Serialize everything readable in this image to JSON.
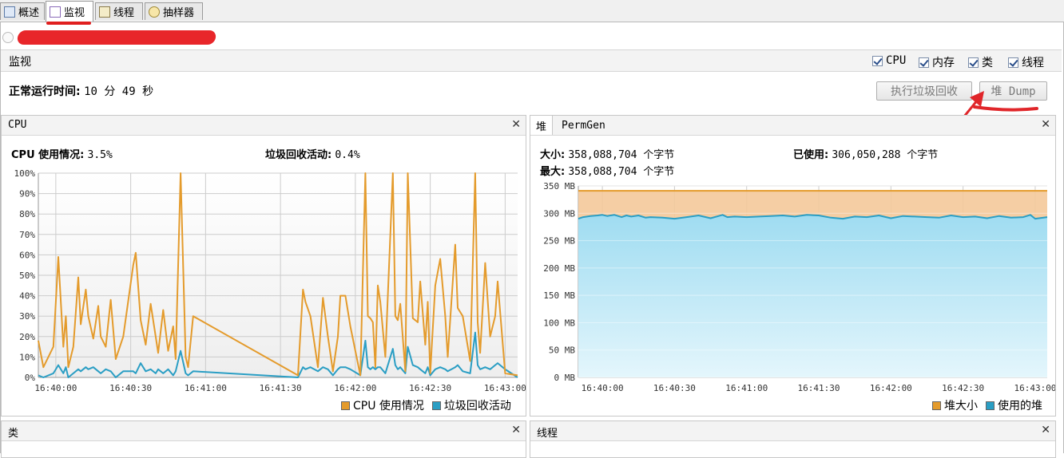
{
  "tabs": [
    {
      "label": "概述",
      "icon": "overview-icon"
    },
    {
      "label": "监视",
      "icon": "monitor-chart-icon"
    },
    {
      "label": "线程",
      "icon": "threads-icon"
    },
    {
      "label": "抽样器",
      "icon": "sampler-icon"
    }
  ],
  "monitor": {
    "title": "监视",
    "checkboxes": [
      {
        "label": "CPU",
        "checked": true
      },
      {
        "label": "内存",
        "checked": true
      },
      {
        "label": "类",
        "checked": true
      },
      {
        "label": "线程",
        "checked": true
      }
    ],
    "uptime_label": "正常运行时间:",
    "uptime_value": "10 分 49 秒",
    "gc_button": "执行垃圾回收",
    "heap_dump_button": "堆 Dump"
  },
  "cpu_panel": {
    "title": "CPU",
    "usage_label": "CPU 使用情况:",
    "usage_value": "3.5%",
    "gc_label": "垃圾回收活动:",
    "gc_value": "0.4%",
    "legend": [
      "CPU 使用情况",
      "垃圾回收活动"
    ],
    "colors": {
      "cpu": "#e49b2c",
      "gc": "#2a9ec4"
    }
  },
  "heap_panel": {
    "tabs": [
      "堆",
      "PermGen"
    ],
    "size_label": "大小:",
    "size_value": "358,088,704 个字节",
    "max_label": "最大:",
    "max_value": "358,088,704 个字节",
    "used_label": "已使用:",
    "used_value": "306,050,288 个字节",
    "legend": [
      "堆大小",
      "使用的堆"
    ],
    "colors": {
      "size": "#e49b2c",
      "used": "#2a9ec4"
    }
  },
  "classes_panel": {
    "title": "类"
  },
  "threads_panel": {
    "title": "线程"
  },
  "chart_data": [
    {
      "type": "line",
      "title": "CPU",
      "x_tick_labels": [
        "16:40:00",
        "16:40:30",
        "16:41:00",
        "16:41:30",
        "16:42:00",
        "16:42:30",
        "16:43:00"
      ],
      "y_tick_labels": [
        "0%",
        "10%",
        "20%",
        "30%",
        "40%",
        "50%",
        "60%",
        "70%",
        "80%",
        "90%",
        "100%"
      ],
      "ylim": [
        0,
        100
      ],
      "xlim_seconds": [
        -7,
        185
      ],
      "series": [
        {
          "name": "CPU 使用情况",
          "x": [
            -7,
            -5,
            -1,
            1,
            3,
            4,
            5,
            7,
            9,
            10,
            12,
            13,
            15,
            17,
            18,
            20,
            22,
            24,
            27,
            31,
            32,
            34,
            36,
            38,
            40,
            41,
            43,
            45,
            47,
            48,
            50,
            52,
            53,
            55,
            97,
            99,
            100,
            102,
            105,
            107,
            109,
            111,
            113,
            114,
            116,
            118,
            122,
            124,
            125,
            126,
            127,
            128,
            129,
            130,
            132,
            135,
            136,
            137,
            138,
            140,
            141,
            143,
            145,
            146,
            148,
            149,
            150,
            152,
            154,
            156,
            157,
            160,
            161,
            163,
            166,
            168,
            169,
            170,
            172,
            174,
            176,
            177,
            180,
            185
          ],
          "y": [
            18,
            5,
            15,
            59,
            15,
            30,
            5,
            15,
            49,
            26,
            43,
            30,
            19,
            35,
            20,
            15,
            38,
            9,
            20,
            55,
            61,
            28,
            16,
            36,
            20,
            12,
            33,
            13,
            25,
            9,
            100,
            10,
            5,
            30,
            1,
            43,
            37,
            30,
            5,
            39,
            20,
            3,
            20,
            40,
            40,
            25,
            1,
            100,
            30,
            29,
            27,
            5,
            45,
            37,
            10,
            100,
            30,
            28,
            36,
            3,
            100,
            29,
            27,
            47,
            16,
            37,
            2,
            45,
            58,
            30,
            10,
            65,
            34,
            30,
            8,
            100,
            27,
            12,
            56,
            20,
            30,
            47,
            2,
            1
          ]
        },
        {
          "name": "垃圾回收活动",
          "x": [
            -7,
            -5,
            -1,
            1,
            3,
            4,
            5,
            7,
            9,
            10,
            12,
            13,
            15,
            17,
            18,
            20,
            22,
            24,
            27,
            31,
            32,
            34,
            36,
            38,
            40,
            41,
            43,
            45,
            47,
            48,
            50,
            52,
            53,
            55,
            97,
            99,
            100,
            102,
            105,
            107,
            109,
            111,
            113,
            114,
            116,
            118,
            122,
            124,
            125,
            126,
            127,
            128,
            129,
            130,
            132,
            135,
            136,
            137,
            138,
            140,
            141,
            143,
            145,
            146,
            148,
            149,
            150,
            152,
            154,
            156,
            157,
            160,
            161,
            163,
            166,
            168,
            169,
            170,
            172,
            174,
            176,
            177,
            180,
            185
          ],
          "y": [
            1,
            0,
            2,
            6,
            2,
            5,
            0,
            2,
            4,
            3,
            5,
            4,
            5,
            3,
            2,
            4,
            3,
            0,
            3,
            3,
            2,
            7,
            3,
            4,
            2,
            4,
            2,
            4,
            1,
            3,
            13,
            2,
            1,
            3,
            0,
            5,
            4,
            5,
            3,
            5,
            4,
            1,
            4,
            5,
            5,
            4,
            1,
            18,
            5,
            4,
            5,
            4,
            5,
            5,
            2,
            14,
            6,
            4,
            5,
            2,
            15,
            6,
            5,
            4,
            2,
            5,
            1,
            4,
            5,
            4,
            3,
            5,
            6,
            3,
            2,
            22,
            6,
            4,
            5,
            4,
            6,
            7,
            4,
            0
          ]
        }
      ]
    },
    {
      "type": "area",
      "title": "堆",
      "x_tick_labels": [
        "16:40:00",
        "16:40:30",
        "16:41:00",
        "16:41:30",
        "16:42:00",
        "16:42:30",
        "16:43:00"
      ],
      "y_tick_labels": [
        "0 MB",
        "50 MB",
        "100 MB",
        "150 MB",
        "200 MB",
        "250 MB",
        "300 MB",
        "350 MB"
      ],
      "ylim": [
        0,
        350
      ],
      "xlim_seconds": [
        -10,
        185
      ],
      "series": [
        {
          "name": "堆大小",
          "x": [
            -10,
            185
          ],
          "y": [
            341,
            341
          ]
        },
        {
          "name": "使用的堆",
          "x": [
            -10,
            -8,
            -5,
            -2,
            0,
            2,
            5,
            8,
            10,
            12,
            15,
            18,
            20,
            25,
            30,
            35,
            40,
            45,
            50,
            52,
            55,
            60,
            65,
            70,
            75,
            80,
            85,
            90,
            95,
            100,
            105,
            110,
            115,
            118,
            120,
            125,
            130,
            135,
            140,
            145,
            150,
            155,
            160,
            165,
            170,
            175,
            178,
            180,
            185
          ],
          "y": [
            290,
            293,
            295,
            296,
            297,
            295,
            297,
            293,
            296,
            294,
            296,
            292,
            293,
            292,
            290,
            293,
            296,
            291,
            297,
            293,
            294,
            293,
            294,
            295,
            296,
            294,
            297,
            296,
            292,
            290,
            294,
            293,
            296,
            293,
            291,
            295,
            294,
            293,
            292,
            296,
            293,
            294,
            291,
            295,
            292,
            293,
            297,
            290,
            293
          ]
        }
      ]
    }
  ]
}
